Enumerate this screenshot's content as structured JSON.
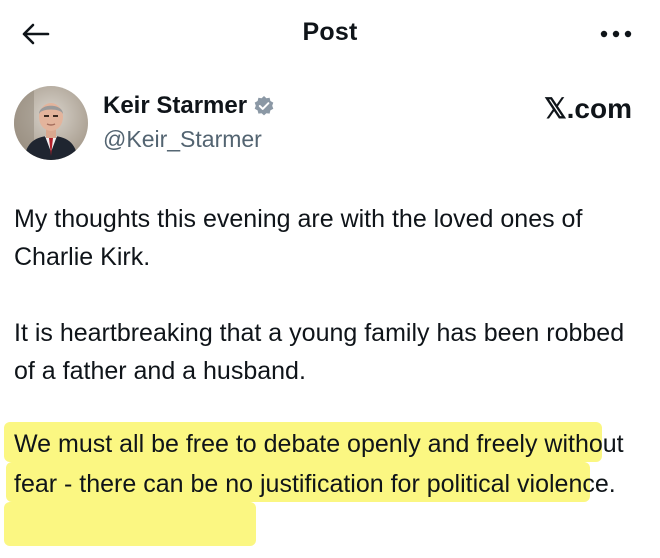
{
  "header": {
    "title": "Post",
    "back_icon": "arrow-left-icon",
    "more_icon": "more-horizontal-icon"
  },
  "author": {
    "name": "Keir Starmer",
    "handle": "@Keir_Starmer",
    "verified_icon": "verified-badge-icon",
    "verified_color": "#8b98a5"
  },
  "brand": {
    "text": "𝕏.com"
  },
  "post": {
    "paragraphs": [
      "My thoughts this evening are with the loved ones of Charlie Kirk.",
      "It is heartbreaking that a young family has been robbed of a father and a husband."
    ],
    "highlighted": "We must all be free to debate openly and freely without fear - there can be no justification for political violence.",
    "highlight_color": "#fbf782"
  }
}
